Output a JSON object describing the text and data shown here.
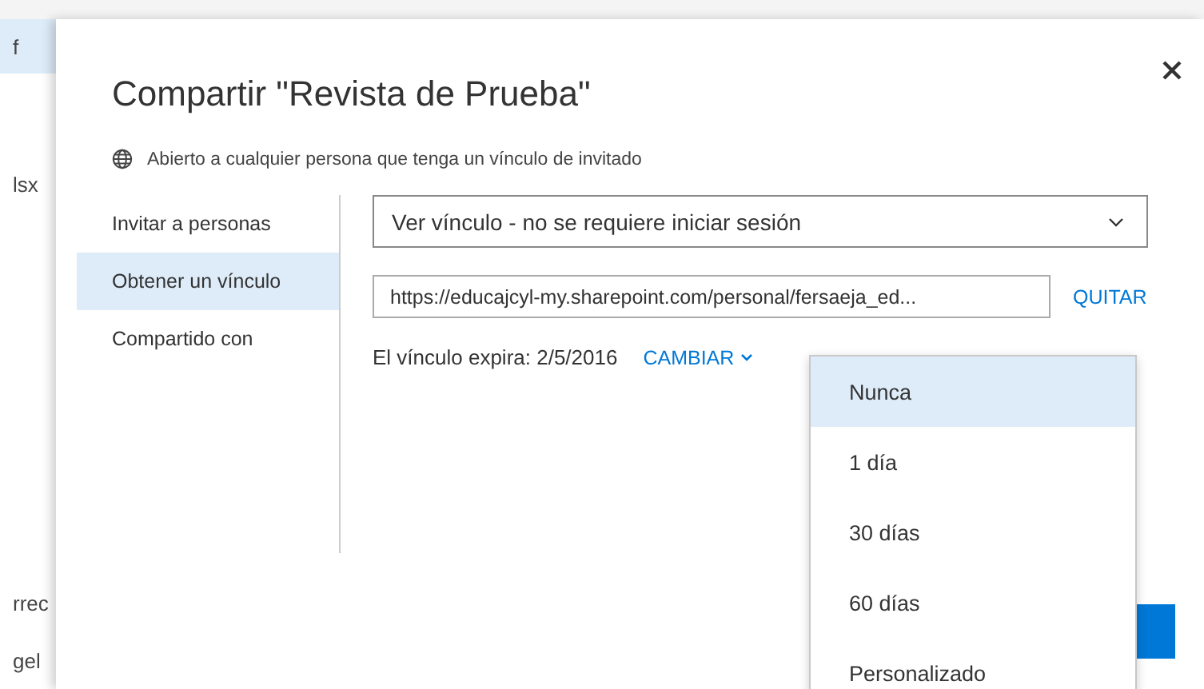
{
  "background_items": [
    {
      "text": "f",
      "selected": true
    },
    {
      "text": "lsx",
      "selected": false
    },
    {
      "text": "rrec",
      "selected": false
    },
    {
      "text": "gel",
      "selected": false
    }
  ],
  "dialog": {
    "title": "Compartir \"Revista de Prueba\"",
    "access_note": "Abierto a cualquier persona que tenga un vínculo de invitado",
    "nav": [
      {
        "label": "Invitar a personas",
        "selected": false
      },
      {
        "label": "Obtener un vínculo",
        "selected": true
      },
      {
        "label": "Compartido con",
        "selected": false
      }
    ],
    "link_type": "Ver vínculo - no se requiere iniciar sesión",
    "link_url": "https://educajcyl-my.sharepoint.com/personal/fersaeja_ed...",
    "remove_link": "QUITAR",
    "expiry": "El vínculo expira: 2/5/2016",
    "change": "CAMBIAR",
    "expiry_options": [
      {
        "label": "Nunca",
        "selected": true
      },
      {
        "label": "1 día",
        "selected": false
      },
      {
        "label": "30 días",
        "selected": false
      },
      {
        "label": "60 días",
        "selected": false
      },
      {
        "label": "Personalizado",
        "selected": false
      }
    ]
  }
}
